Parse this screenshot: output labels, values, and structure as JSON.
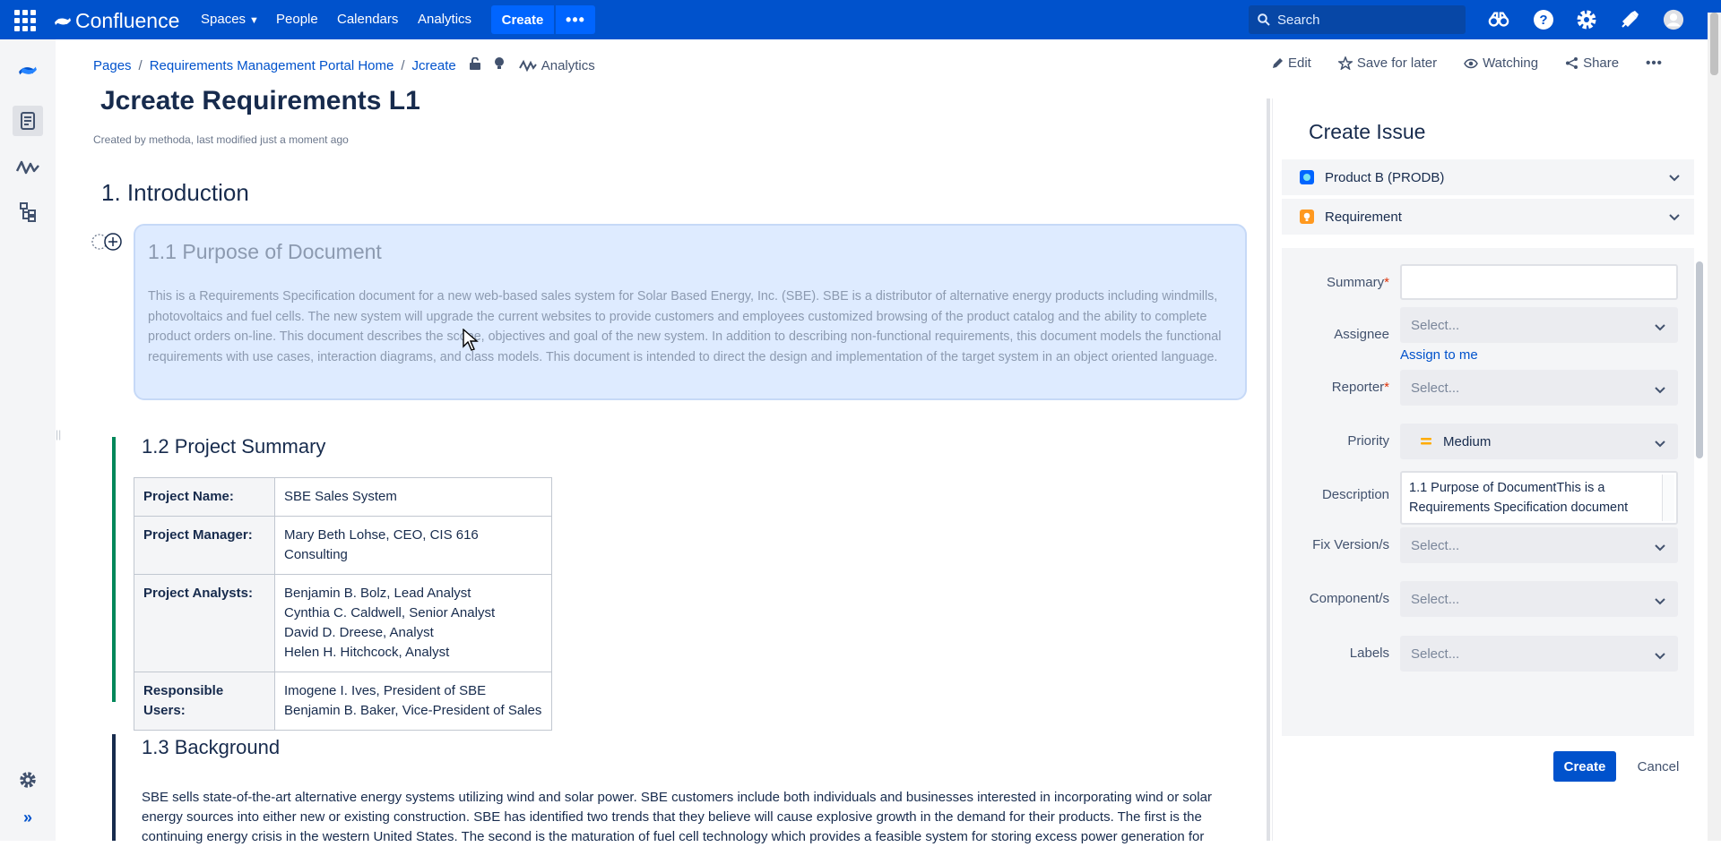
{
  "topnav": {
    "brand": "Confluence",
    "links": [
      "Spaces",
      "People",
      "Calendars",
      "Analytics"
    ],
    "create_label": "Create",
    "more_label": "•••",
    "search_placeholder": "Search",
    "bg_color": "#0052cc",
    "icons": [
      "app-switcher-icon",
      "confluence-logo-icon",
      "binoculars-icon",
      "help-icon",
      "settings-icon",
      "notifications-icon",
      "avatar-icon"
    ]
  },
  "leftrail": {
    "icons": [
      "confluence-logo-icon",
      "pages-icon",
      "analytics-icon",
      "page-tree-icon",
      "settings-icon",
      "expand-icon"
    ]
  },
  "breadcrumbs": {
    "items": [
      "Pages",
      "Requirements Management Portal Home",
      "Jcreate"
    ],
    "analytics_label": "Analytics"
  },
  "actions": {
    "edit": "Edit",
    "save_for_later": "Save for later",
    "watching": "Watching",
    "share": "Share",
    "more": "•••"
  },
  "page": {
    "title": "Jcreate Requirements L1",
    "byline": "Created by methoda, last modified just a moment ago",
    "intro_heading": "1. Introduction",
    "purpose_heading": "1.1 Purpose of Document",
    "purpose_text": "This is a Requirements Specification document for a new web-based sales system for Solar Based Energy, Inc. (SBE). SBE is a distributor of alternative energy products including windmills, photovoltaics and fuel cells. The new system will upgrade the current websites to provide customers and employees customized browsing of the product catalog and the ability to complete product orders on-line. This document describes the scope, objectives and goal of the new system. In addition to describing non-functional requirements, this document models the functional requirements with use cases, interaction diagrams, and class models. This document is intended to direct the design and implementation of the target system in an object oriented language.",
    "summary_heading": "1.2 Project Summary",
    "project_table": [
      {
        "label": "Project Name:",
        "value": "SBE Sales System"
      },
      {
        "label": "Project Manager:",
        "value": "Mary Beth Lohse, CEO, CIS 616 Consulting"
      },
      {
        "label": "Project Analysts:",
        "value": "Benjamin B. Bolz, Lead Analyst\nCynthia C. Caldwell, Senior Analyst\nDavid D. Dreese, Analyst\nHelen H. Hitchcock, Analyst"
      },
      {
        "label": "Responsible Users:",
        "value": "Imogene I. Ives, President of SBE\nBenjamin B. Baker, Vice-President of Sales"
      }
    ],
    "background_heading": "1.3 Background",
    "background_text": "SBE sells state-of-the-art alternative energy systems utilizing wind and solar power. SBE customers include both individuals and businesses interested in incorporating wind or solar energy sources into either new or existing construction. SBE has identified two trends that they believe will cause explosive growth in the demand for their products. The first is the continuing energy crisis in the western United States. The second is the maturation of fuel cell technology which provides a feasible system for storing excess power generation for",
    "summary_bar_color": "#00875a",
    "background_bar_color": "#172b4d"
  },
  "panel": {
    "title": "Create Issue",
    "project": "Product B (PRODB)",
    "issue_type": "Requirement",
    "fields": {
      "summary_label": "Summary",
      "assignee_label": "Assignee",
      "assignee_value": "Select...",
      "assign_to_me": "Assign to me",
      "reporter_label": "Reporter",
      "reporter_value": "Select...",
      "priority_label": "Priority",
      "priority_value": "Medium",
      "description_label": "Description",
      "description_value": "1.1 Purpose of DocumentThis is a Requirements Specification document",
      "fix_version_label": "Fix Version/s",
      "fix_version_value": "Select...",
      "component_label": "Component/s",
      "component_value": "Select...",
      "labels_label": "Labels",
      "labels_value": "Select...",
      "required_mark": "*"
    },
    "create_label": "Create",
    "cancel_label": "Cancel"
  }
}
